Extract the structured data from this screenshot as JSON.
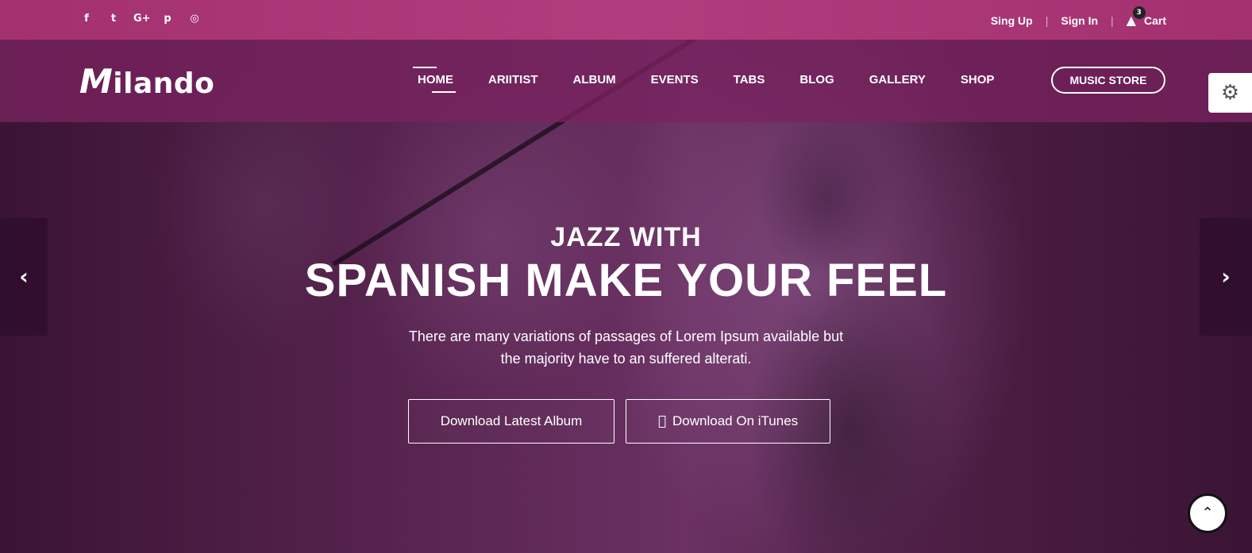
{
  "topbar": {
    "social_icons": [
      "facebook-icon",
      "twitter-icon",
      "google-plus-icon",
      "pinterest-icon",
      "instagram-icon"
    ],
    "social_glyphs": [
      "f",
      "t",
      "G+",
      "p",
      "◎"
    ],
    "signup": "Sing Up",
    "signin": "Sign In",
    "cart_label": "Cart",
    "cart_count": "3"
  },
  "navbar": {
    "logo": "Milando",
    "logo_first": "M",
    "logo_rest": "ilando",
    "menu": [
      "HOME",
      "ARIITIST",
      "ALBUM",
      "EVENTS",
      "TABS",
      "BLOG",
      "GALLERY",
      "SHOP"
    ],
    "active_item": "HOME",
    "store_button": "MUSIC STORE"
  },
  "hero": {
    "eyebrow": "JAZZ WITH",
    "headline": "SPANISH MAKE YOUR FEEL",
    "desc_line1": "There are many variations of passages of Lorem Ipsum available but",
    "desc_line2": "the majority have to an suffered alterati.",
    "btn_album": "Download Latest Album",
    "btn_itunes": "Download On iTunes"
  },
  "colors": {
    "topbar": "#a3306f",
    "navbar": "#7a2360",
    "hero_overlay": "#5a2552"
  }
}
